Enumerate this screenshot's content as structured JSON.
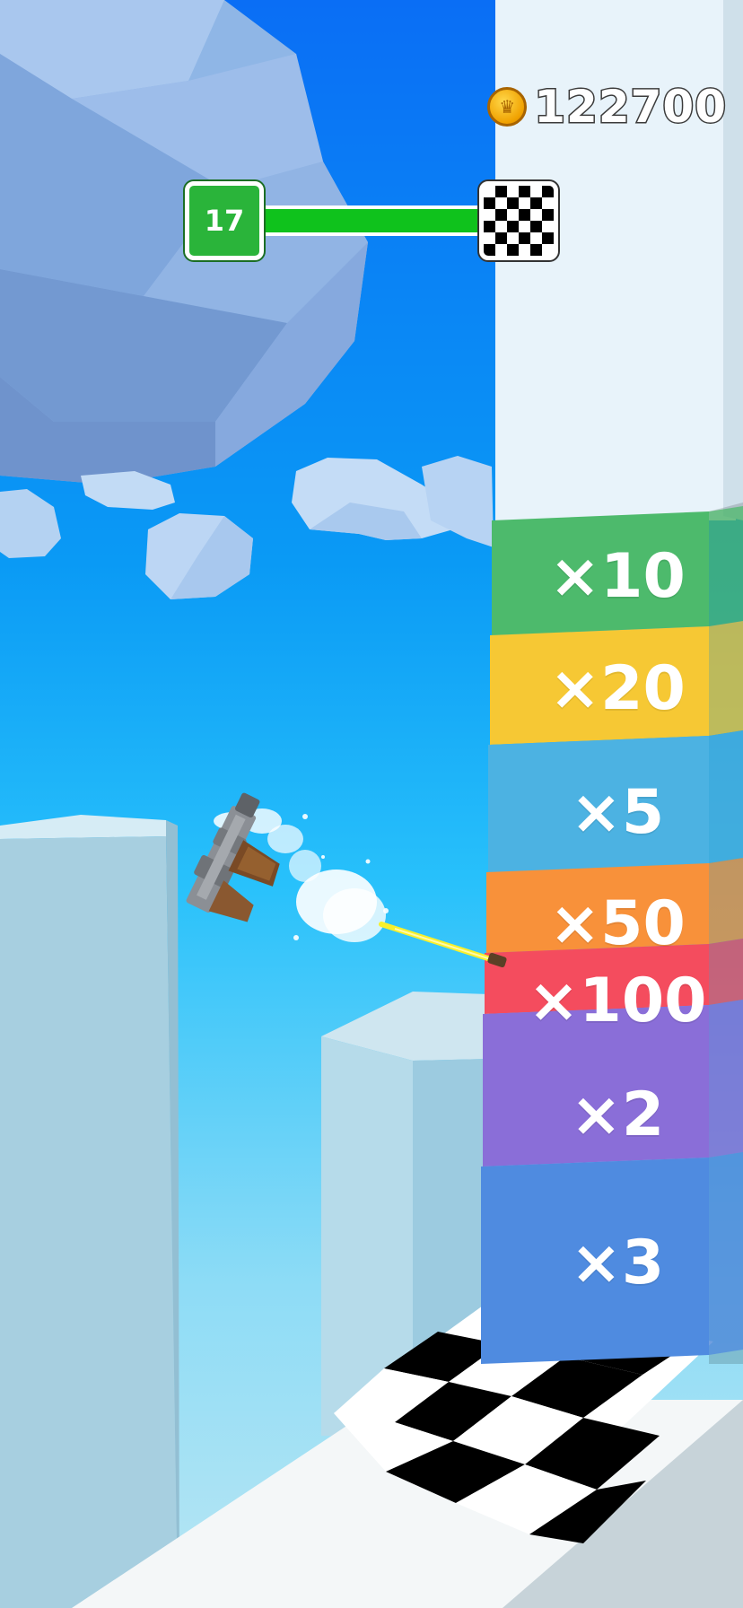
{
  "hud": {
    "coins": "122700",
    "coin_icon": "coin-crown-icon",
    "level": "17",
    "level_progress": 0.93,
    "finish_icon": "checkered-flag-icon"
  },
  "multipliers": [
    {
      "label": "×10",
      "color": "#4dba6c"
    },
    {
      "label": "×20",
      "color": "#f6c834"
    },
    {
      "label": "×5",
      "color": "#4cb2e2"
    },
    {
      "label": "×50",
      "color": "#f8913a"
    },
    {
      "label": "×100",
      "color": "#f44c5e"
    },
    {
      "label": "×2",
      "color": "#8a6ed8"
    },
    {
      "label": "×3",
      "color": "#4f8be0"
    }
  ],
  "scene": {
    "player": "flipping-pistol",
    "sky_color": "#0a9af5",
    "finish_floor": "checkered-finish-line"
  }
}
